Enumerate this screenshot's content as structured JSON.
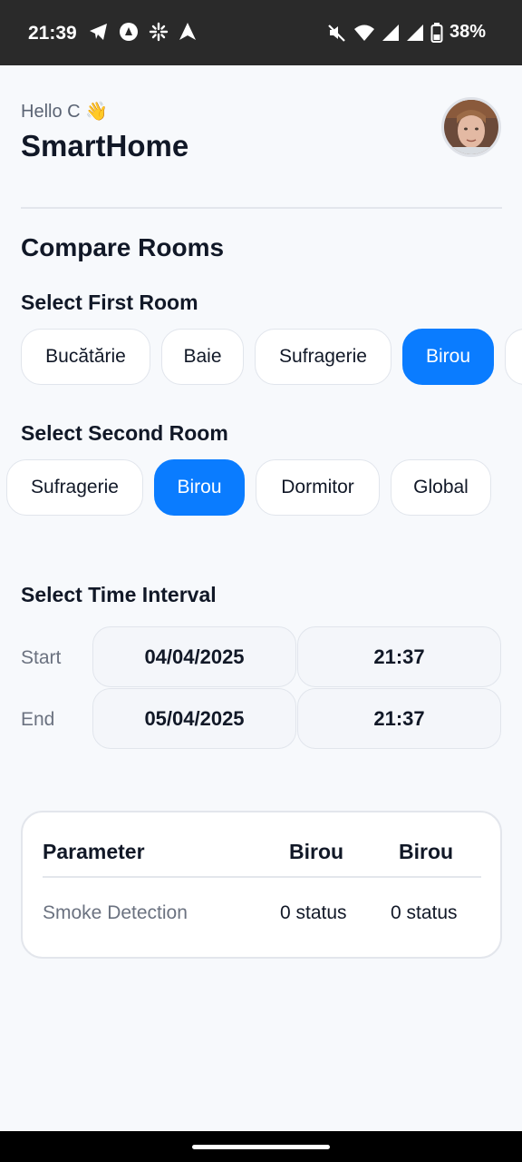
{
  "status_bar": {
    "time": "21:39",
    "battery": "38%",
    "icons_left": [
      "telegram-icon",
      "app-icon",
      "sparkle-icon",
      "navigation-icon"
    ],
    "icons_right": [
      "mute-icon",
      "wifi-icon",
      "signal-icon",
      "signal-icon",
      "battery-icon"
    ]
  },
  "header": {
    "greeting": "Hello C 👋",
    "title": "SmartHome"
  },
  "compare": {
    "title": "Compare Rooms",
    "first_label": "Select First Room",
    "first_rooms": [
      "Bucătărie",
      "Baie",
      "Sufragerie",
      "Birou",
      ""
    ],
    "first_selected": "Birou",
    "second_label": "Select Second Room",
    "second_rooms": [
      "Sufragerie",
      "Birou",
      "Dormitor",
      "Global"
    ],
    "second_selected": "Birou"
  },
  "interval": {
    "title": "Select Time Interval",
    "start_label": "Start",
    "start_date": "04/04/2025",
    "start_time": "21:37",
    "end_label": "End",
    "end_date": "05/04/2025",
    "end_time": "21:37"
  },
  "table": {
    "headers": [
      "Parameter",
      "Birou",
      "Birou"
    ],
    "rows": [
      [
        "Smoke Detection",
        "0 status",
        "0 status"
      ]
    ]
  },
  "colors": {
    "accent": "#0a7cff",
    "status_bar": "#2a2a2a",
    "background": "#f7f9fc"
  }
}
